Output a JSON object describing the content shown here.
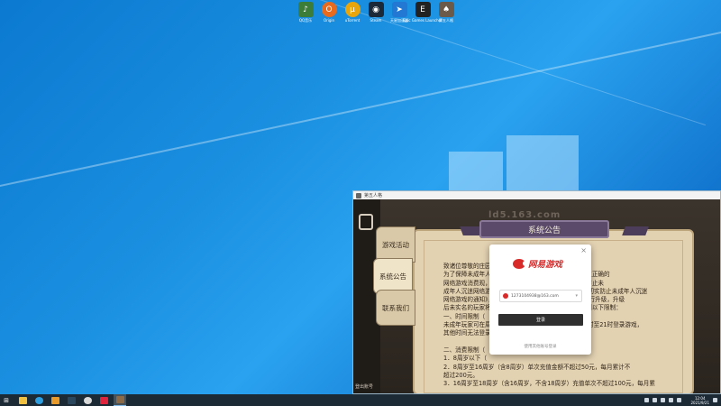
{
  "desktop": {
    "icons": [
      {
        "label": "QQ音乐",
        "icon": "qq-music-icon",
        "color": "#3d7d3a"
      },
      {
        "label": "Origin",
        "icon": "origin-icon",
        "color": "#e86a1d"
      },
      {
        "label": "uTorrent",
        "icon": "utorrent-icon",
        "color": "#e8a50c"
      },
      {
        "label": "Steam",
        "icon": "steam-icon",
        "color": "#1b2838"
      },
      {
        "label": "天星加速器",
        "icon": "accelerator-icon",
        "color": "#2378d4"
      },
      {
        "label": "Epic Games Launcher",
        "icon": "epic-games-icon",
        "color": "#222222"
      },
      {
        "label": "第五人格",
        "icon": "identity-v-icon",
        "color": "#6b5a4a"
      }
    ]
  },
  "game_window": {
    "title": "第五人格",
    "bg_text": "ld5.163.com",
    "bottom_left_text": "登出账号",
    "tabs": [
      {
        "label": "游戏活动"
      },
      {
        "label": "系统公告"
      },
      {
        "label": "联系我们"
      }
    ],
    "banner_title": "系统公告",
    "notice_lines": [
      "致诸位尊敬的庄园访客：",
      "      为了保障未成年人身心健康，引导其合理健康游戏，树立正确的",
      "网络游戏消费观，出台了国家新闻出版署发布的《关于防止未",
      "成年人沉迷网络游戏的通知》和《关于进一步严格管理 切实防止未成年人沉迷",
      "网络游戏的通知》，为了配合落实，我们对防沉迷系统进行升级，升级",
      "后未实名的玩家将无法进入游戏，未成年人游戏将会受到以下限制：",
      "一、时间限制（",
      "未成年玩家可在周五、周六、周日和法定节假日每日20时至21时登录游戏，",
      "其他时间无法登录游戏。",
      "",
      "二、消费限制（",
      "1．8周岁以下（",
      "2．8周岁至16周岁（含8周岁）单次充值金额不超过50元，每月累计不",
      "超过200元。",
      "3．16周岁至18周岁（含16周岁，不含18周岁）充值单次不超过100元，每月累"
    ]
  },
  "login_dialog": {
    "close_label": "×",
    "brand": "网易游戏",
    "account": "1273104938@163.com",
    "login_label": "登录",
    "other_link": "使用其他账号登录"
  },
  "taskbar": {
    "start_label": "⊞",
    "items": [
      {
        "icon": "file-explorer-icon",
        "color": "#f0c040"
      },
      {
        "icon": "edge-icon",
        "color": "#2d9ee0"
      },
      {
        "icon": "folder-icon",
        "color": "#e89a2a"
      },
      {
        "icon": "steam-taskbar-icon",
        "color": "#2a475e"
      },
      {
        "icon": "browser-icon",
        "color": "#d9d9d9"
      },
      {
        "icon": "app-icon",
        "color": "#e0243d"
      },
      {
        "icon": "game-taskbar-icon",
        "color": "#8b6a4a",
        "active": true
      }
    ],
    "time": "12:04",
    "date": "2021/9/21"
  }
}
